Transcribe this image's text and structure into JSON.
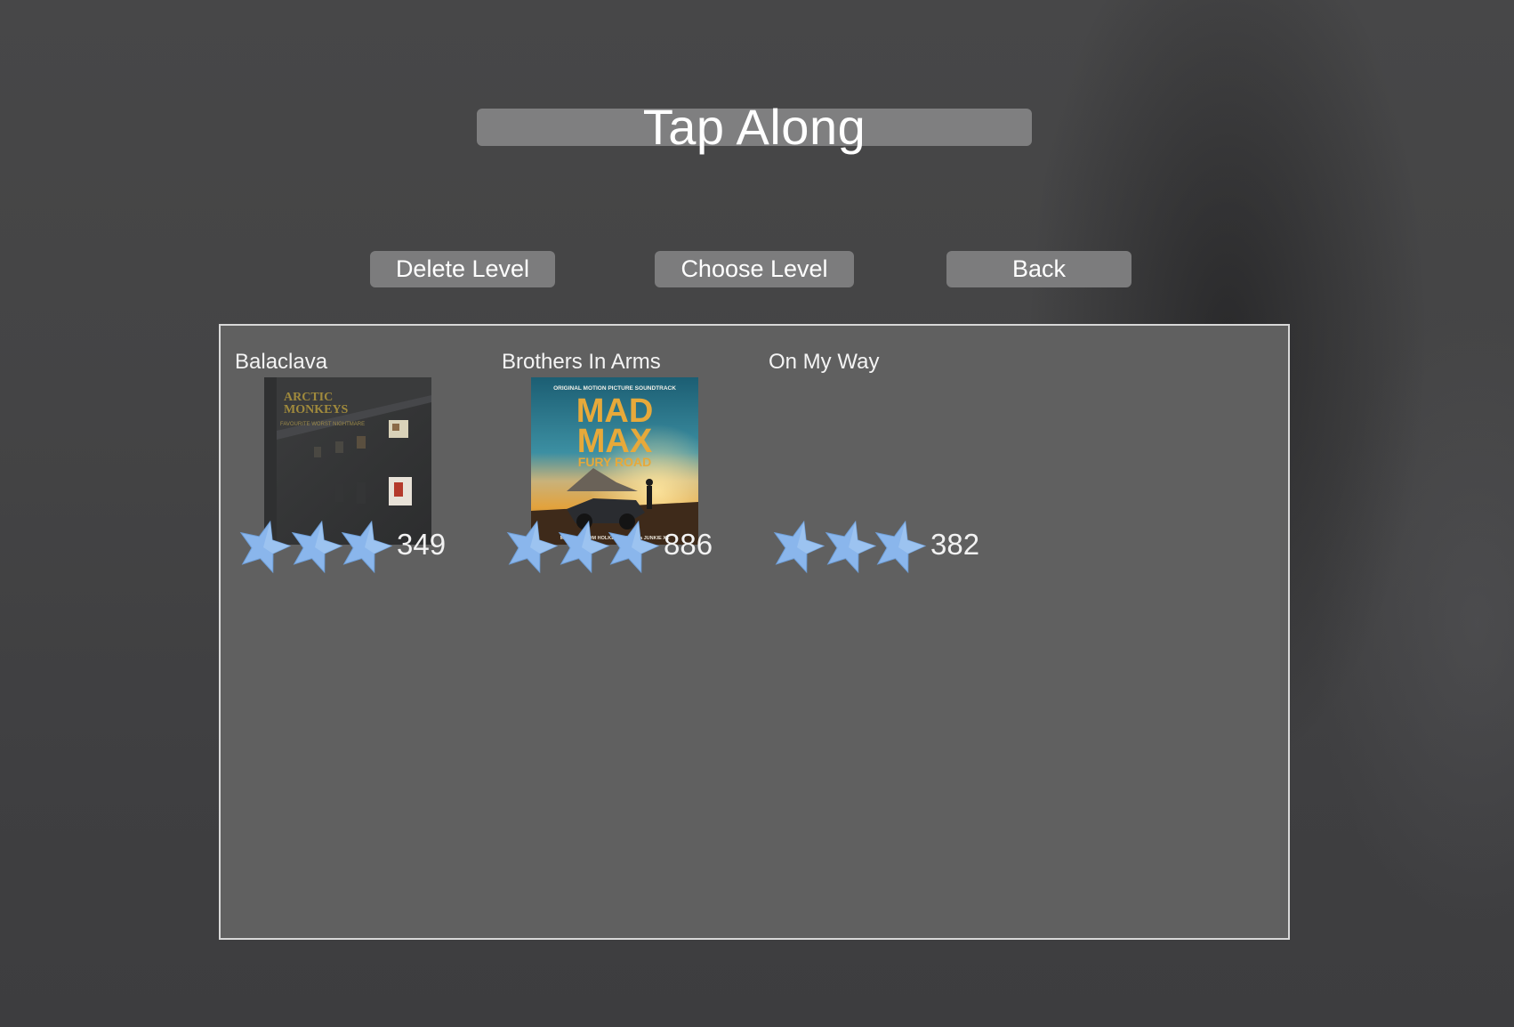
{
  "app": {
    "title": "Tap Along"
  },
  "toolbar": {
    "delete_label": "Delete Level",
    "choose_label": "Choose Level",
    "back_label": "Back"
  },
  "levels": [
    {
      "name": "Balaclava",
      "stars": 3,
      "score": "349",
      "art": "album-cover-dark-building"
    },
    {
      "name": "Brothers In Arms",
      "stars": 3,
      "score": "886",
      "art": "album-cover-mad-max"
    },
    {
      "name": "On My Way",
      "stars": 3,
      "score": "382",
      "art": "none"
    }
  ],
  "album_art": {
    "mad_max": {
      "top_line": "ORIGINAL MOTION PICTURE SOUNDTRACK",
      "line1": "MAD",
      "line2": "MAX",
      "line3": "FURY ROAD",
      "bottom_line": "MUSIC BY TOM HOLKENBORG aka JUNKIE XL"
    }
  },
  "colors": {
    "star": "#8ab6ec",
    "panel": "#606060",
    "button": "#7c7c7d",
    "title_bar": "#7f7f80"
  }
}
